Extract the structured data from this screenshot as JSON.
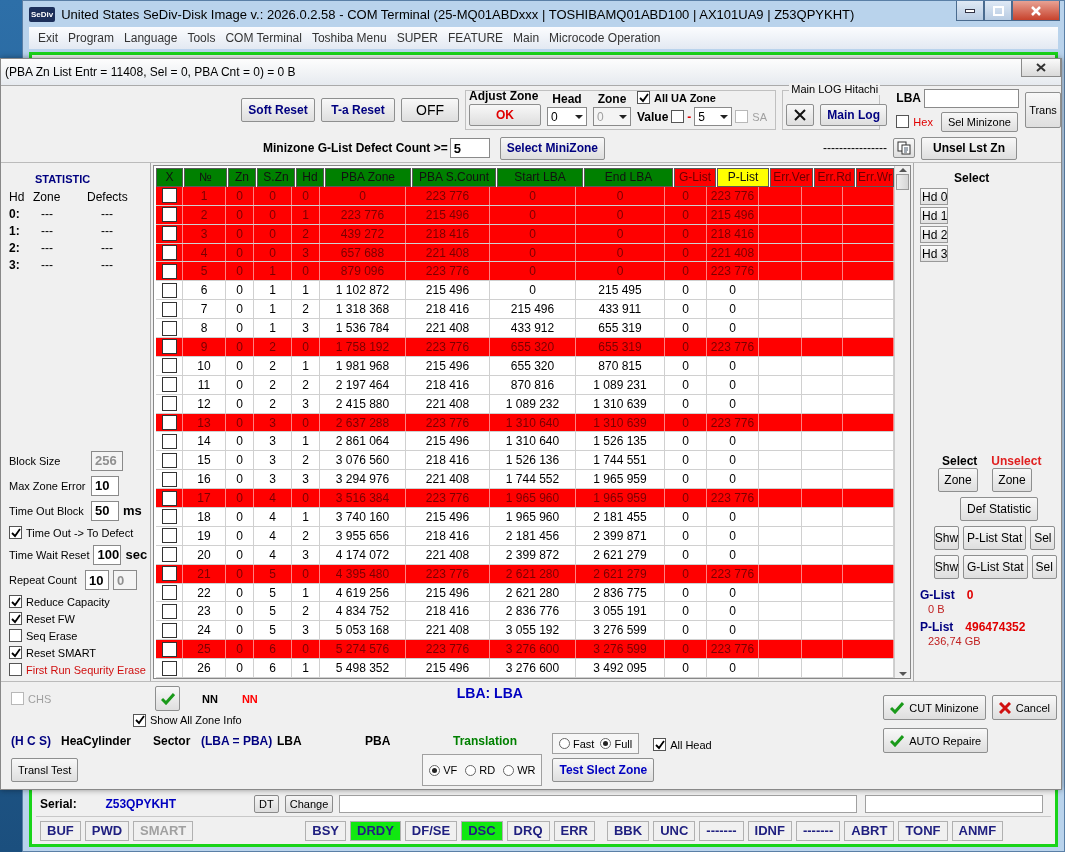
{
  "window": {
    "logo": "SeDiv",
    "title": "United States  SeDiv-Disk Image v.: 2026.0.2.58 - COM Terminal  (25-MQ01ABDxxx | TOSHIBAMQ01ABD100 | AX101UA9 | Z53QPYKHT)"
  },
  "menu": [
    "Exit",
    "Program",
    "Language",
    "Tools",
    "COM Terminal",
    "Toshiba Menu",
    "SUPER",
    "FEATURE",
    "Main",
    "Microcode Operation"
  ],
  "dialog": {
    "title": "(PBA Zn List Entr = 11408, Sel = 0, PBA Cnt = 0) = 0 B",
    "toolbar": {
      "buttons": [
        {
          "label": "Soft Reset",
          "kind": "accent"
        },
        {
          "label": "T-a Reset",
          "kind": "accent"
        },
        {
          "label": "OFF",
          "kind": "plain"
        }
      ],
      "adjust_zone": {
        "title": "Adjust Zone",
        "ok": "OK",
        "head_label": "Head",
        "head_value": "0",
        "zone_label": "Zone",
        "zone_value": "0",
        "zone_disabled": true,
        "all_ua_zone": {
          "label": "All UA Zone",
          "checked": true,
          "disabled": false
        },
        "value": {
          "label": "Value",
          "checked": false,
          "disabled": false
        },
        "value_sign": "-",
        "value_select": "5",
        "sa": {
          "label": "SA",
          "checked": false,
          "disabled": true
        }
      },
      "main_log": {
        "title": "Main LOG Hitachi",
        "button": "Main Log"
      },
      "lba": {
        "label": "LBA",
        "hex": {
          "label": "Hex",
          "checked": false,
          "disabled": false
        },
        "sel_minizone": "Sel Minizone",
        "trans": "Trans"
      },
      "minizone": {
        "label": "Minizone G-List Defect Count >=",
        "value": "5",
        "button": "Select MiniZone",
        "dashes": "----------------",
        "unsel": "Unsel Lst Zn"
      }
    },
    "statistic": {
      "title": "STATISTIC",
      "columns": [
        "Hd",
        "Zone",
        "Defects"
      ],
      "rows": [
        [
          "0:",
          "---",
          "---"
        ],
        [
          "1:",
          "---",
          "---"
        ],
        [
          "2:",
          "---",
          "---"
        ],
        [
          "3:",
          "---",
          "---"
        ]
      ]
    },
    "settings": [
      {
        "kind": "field",
        "label": "Block Size",
        "value": "256",
        "disabled": true
      },
      {
        "kind": "field",
        "label": "Max Zone Error",
        "value": "10",
        "disabled": false
      },
      {
        "kind": "field",
        "label": "Time Out Block",
        "value": "50",
        "unit": "ms",
        "disabled": false
      },
      {
        "kind": "check",
        "label": "Time Out  -> To Defect",
        "checked": true
      },
      {
        "kind": "field",
        "label": "Time Wait Reset",
        "value": "100",
        "unit": "sec",
        "disabled": false
      },
      {
        "kind": "pair",
        "label": "Repeat Count",
        "value": "10",
        "value2": "0",
        "disabled": false
      }
    ],
    "options": [
      {
        "label": "Reduce Capacity",
        "checked": true,
        "warning": false
      },
      {
        "label": "Reset FW",
        "checked": true,
        "warning": false
      },
      {
        "label": "Seq Erase",
        "checked": false,
        "warning": false
      },
      {
        "label": "Reset SMART",
        "checked": true,
        "warning": false
      },
      {
        "label": "First Run Sequrity Erase",
        "checked": false,
        "warning": true
      }
    ],
    "table": {
      "columns": [
        {
          "label": "X",
          "color": "#008000"
        },
        {
          "label": "№",
          "color": "#008000"
        },
        {
          "label": "Zn",
          "color": "#008000"
        },
        {
          "label": "S.Zn",
          "color": "#008000"
        },
        {
          "label": "Hd",
          "color": "#008000"
        },
        {
          "label": "PBA Zone",
          "color": "#008000"
        },
        {
          "label": "PBA S.Count",
          "color": "#008000"
        },
        {
          "label": "Start LBA",
          "color": "#008000"
        },
        {
          "label": "End LBA",
          "color": "#008000"
        },
        {
          "label": "G-List",
          "color": "#ff0000"
        },
        {
          "label": "P-List",
          "color": "#ffff00"
        },
        {
          "label": "Err.Ver",
          "color": "#ff0000"
        },
        {
          "label": "Err.Rd",
          "color": "#ff0000"
        },
        {
          "label": "Err.Wr",
          "color": "#ff0000"
        }
      ],
      "rows": [
        {
          "checked": false,
          "flagged": true,
          "cells": [
            "",
            "1",
            "0",
            "0",
            "0",
            "0",
            "223 776",
            "0",
            "0",
            "0",
            "223 776"
          ]
        },
        {
          "checked": false,
          "flagged": true,
          "cells": [
            "",
            "2",
            "0",
            "0",
            "1",
            "223 776",
            "215 496",
            "0",
            "0",
            "0",
            "215 496"
          ]
        },
        {
          "checked": false,
          "flagged": true,
          "cells": [
            "",
            "3",
            "0",
            "0",
            "2",
            "439 272",
            "218 416",
            "0",
            "0",
            "0",
            "218 416"
          ]
        },
        {
          "checked": false,
          "flagged": true,
          "cells": [
            "",
            "4",
            "0",
            "0",
            "3",
            "657 688",
            "221 408",
            "0",
            "0",
            "0",
            "221 408"
          ]
        },
        {
          "checked": false,
          "flagged": true,
          "cells": [
            "",
            "5",
            "0",
            "1",
            "0",
            "879 096",
            "223 776",
            "0",
            "0",
            "0",
            "223 776"
          ]
        },
        {
          "checked": false,
          "flagged": false,
          "cells": [
            "",
            "6",
            "0",
            "1",
            "1",
            "1 102 872",
            "215 496",
            "0",
            "215 495",
            "0",
            "0"
          ]
        },
        {
          "checked": false,
          "flagged": false,
          "cells": [
            "",
            "7",
            "0",
            "1",
            "2",
            "1 318 368",
            "218 416",
            "215 496",
            "433 911",
            "0",
            "0"
          ]
        },
        {
          "checked": false,
          "flagged": false,
          "cells": [
            "",
            "8",
            "0",
            "1",
            "3",
            "1 536 784",
            "221 408",
            "433 912",
            "655 319",
            "0",
            "0"
          ]
        },
        {
          "checked": false,
          "flagged": true,
          "cells": [
            "",
            "9",
            "0",
            "2",
            "0",
            "1 758 192",
            "223 776",
            "655 320",
            "655 319",
            "0",
            "223 776"
          ]
        },
        {
          "checked": false,
          "flagged": false,
          "cells": [
            "",
            "10",
            "0",
            "2",
            "1",
            "1 981 968",
            "215 496",
            "655 320",
            "870 815",
            "0",
            "0"
          ]
        },
        {
          "checked": false,
          "flagged": false,
          "cells": [
            "",
            "11",
            "0",
            "2",
            "2",
            "2 197 464",
            "218 416",
            "870 816",
            "1 089 231",
            "0",
            "0"
          ]
        },
        {
          "checked": false,
          "flagged": false,
          "cells": [
            "",
            "12",
            "0",
            "2",
            "3",
            "2 415 880",
            "221 408",
            "1 089 232",
            "1 310 639",
            "0",
            "0"
          ]
        },
        {
          "checked": false,
          "flagged": true,
          "cells": [
            "",
            "13",
            "0",
            "3",
            "0",
            "2 637 288",
            "223 776",
            "1 310 640",
            "1 310 639",
            "0",
            "223 776"
          ]
        },
        {
          "checked": false,
          "flagged": false,
          "cells": [
            "",
            "14",
            "0",
            "3",
            "1",
            "2 861 064",
            "215 496",
            "1 310 640",
            "1 526 135",
            "0",
            "0"
          ]
        },
        {
          "checked": false,
          "flagged": false,
          "cells": [
            "",
            "15",
            "0",
            "3",
            "2",
            "3 076 560",
            "218 416",
            "1 526 136",
            "1 744 551",
            "0",
            "0"
          ]
        },
        {
          "checked": false,
          "flagged": false,
          "cells": [
            "",
            "16",
            "0",
            "3",
            "3",
            "3 294 976",
            "221 408",
            "1 744 552",
            "1 965 959",
            "0",
            "0"
          ]
        },
        {
          "checked": false,
          "flagged": true,
          "cells": [
            "",
            "17",
            "0",
            "4",
            "0",
            "3 516 384",
            "223 776",
            "1 965 960",
            "1 965 959",
            "0",
            "223 776"
          ]
        },
        {
          "checked": false,
          "flagged": false,
          "cells": [
            "",
            "18",
            "0",
            "4",
            "1",
            "3 740 160",
            "215 496",
            "1 965 960",
            "2 181 455",
            "0",
            "0"
          ]
        },
        {
          "checked": false,
          "flagged": false,
          "cells": [
            "",
            "19",
            "0",
            "4",
            "2",
            "3 955 656",
            "218 416",
            "2 181 456",
            "2 399 871",
            "0",
            "0"
          ]
        },
        {
          "checked": false,
          "flagged": false,
          "cells": [
            "",
            "20",
            "0",
            "4",
            "3",
            "4 174 072",
            "221 408",
            "2 399 872",
            "2 621 279",
            "0",
            "0"
          ]
        },
        {
          "checked": false,
          "flagged": true,
          "cells": [
            "",
            "21",
            "0",
            "5",
            "0",
            "4 395 480",
            "223 776",
            "2 621 280",
            "2 621 279",
            "0",
            "223 776"
          ]
        },
        {
          "checked": false,
          "flagged": false,
          "cells": [
            "",
            "22",
            "0",
            "5",
            "1",
            "4 619 256",
            "215 496",
            "2 621 280",
            "2 836 775",
            "0",
            "0"
          ]
        },
        {
          "checked": false,
          "flagged": false,
          "cells": [
            "",
            "23",
            "0",
            "5",
            "2",
            "4 834 752",
            "218 416",
            "2 836 776",
            "3 055 191",
            "0",
            "0"
          ]
        },
        {
          "checked": false,
          "flagged": false,
          "cells": [
            "",
            "24",
            "0",
            "5",
            "3",
            "5 053 168",
            "221 408",
            "3 055 192",
            "3 276 599",
            "0",
            "0"
          ]
        },
        {
          "checked": false,
          "flagged": true,
          "cells": [
            "",
            "25",
            "0",
            "6",
            "0",
            "5 274 576",
            "223 776",
            "3 276 600",
            "3 276 599",
            "0",
            "223 776"
          ]
        },
        {
          "checked": false,
          "flagged": false,
          "cells": [
            "",
            "26",
            "0",
            "6",
            "1",
            "5 498 352",
            "215 496",
            "3 276 600",
            "3 492 095",
            "0",
            "0"
          ]
        }
      ]
    },
    "right_panel": {
      "select_title": "Select",
      "heads": [
        "Hd 0",
        "Hd 1",
        "Hd 2",
        "Hd 3"
      ],
      "select_label": "Select",
      "unselect_label": "Unselect",
      "zone_buttons": [
        "Zone",
        "Zone"
      ],
      "def_statistic": "Def Statistic",
      "list_rows": [
        [
          "Shw",
          "P-List Stat",
          "Sel"
        ],
        [
          "Shw",
          "G-List Stat",
          "Sel"
        ]
      ],
      "totals": [
        {
          "label": "G-List",
          "count": "0",
          "size": "0 B"
        },
        {
          "label": "P-List",
          "count": "496474352",
          "size": "236,74 GB"
        }
      ]
    },
    "bottom": {
      "chs": {
        "label": "CHS",
        "checked": false,
        "disabled": true
      },
      "nn": [
        {
          "text": "NN",
          "color": "#000000"
        },
        {
          "text": "NN",
          "color": "#ff0000"
        }
      ],
      "lba_title": "LBA: LBA",
      "show_all": {
        "label": "Show All Zone Info",
        "checked": true,
        "disabled": false
      },
      "translation_row": [
        {
          "text": "(H C S)",
          "color": "#000080"
        },
        {
          "text": "HeaCylinder",
          "color": "#000000"
        },
        {
          "text": "Sector",
          "color": "#000000"
        },
        {
          "text": "(LBA = PBA)",
          "color": "#000080"
        },
        {
          "text": "LBA",
          "color": "#000000"
        },
        {
          "text": "PBA",
          "color": "#000000"
        },
        {
          "text": "Translation",
          "color": "#008000"
        }
      ],
      "transl_test": "Transl Test",
      "speed": [
        {
          "label": "Fast",
          "selected": false
        },
        {
          "label": "Full",
          "selected": true
        }
      ],
      "all_head": {
        "label": "All Head",
        "checked": true,
        "disabled": false
      },
      "mode": [
        {
          "label": "VF",
          "selected": true
        },
        {
          "label": "RD",
          "selected": false
        },
        {
          "label": "WR",
          "selected": false
        }
      ],
      "test_button": "Test Slect Zone",
      "cut": "CUT Minizone",
      "cancel": "Cancel",
      "auto": "AUTO Repaire"
    }
  },
  "serial": {
    "label": "Serial:",
    "value": "Z53QPYKHT",
    "dt": "DT",
    "change": "Change"
  },
  "status_groups": [
    [
      {
        "label": "BUF",
        "lit": false,
        "disabled": false
      },
      {
        "label": "PWD",
        "lit": false,
        "disabled": false
      },
      {
        "label": "SMART",
        "lit": false,
        "disabled": true
      }
    ],
    [
      {
        "label": "BSY",
        "lit": false,
        "disabled": false
      },
      {
        "label": "DRDY",
        "lit": true,
        "disabled": false
      },
      {
        "label": "DF/SE",
        "lit": false,
        "disabled": false
      },
      {
        "label": "DSC",
        "lit": true,
        "disabled": false
      },
      {
        "label": "DRQ",
        "lit": false,
        "disabled": false
      },
      {
        "label": "ERR",
        "lit": false,
        "disabled": false
      }
    ],
    [
      {
        "label": "BBK",
        "lit": false,
        "disabled": false
      },
      {
        "label": "UNC",
        "lit": false,
        "disabled": false
      },
      {
        "label": "-------",
        "lit": false,
        "disabled": false
      },
      {
        "label": "IDNF",
        "lit": false,
        "disabled": false
      },
      {
        "label": "-------",
        "lit": false,
        "disabled": false
      },
      {
        "label": "ABRT",
        "lit": false,
        "disabled": false
      },
      {
        "label": "TONF",
        "lit": false,
        "disabled": false
      },
      {
        "label": "ANMF",
        "lit": false,
        "disabled": false
      }
    ]
  ]
}
